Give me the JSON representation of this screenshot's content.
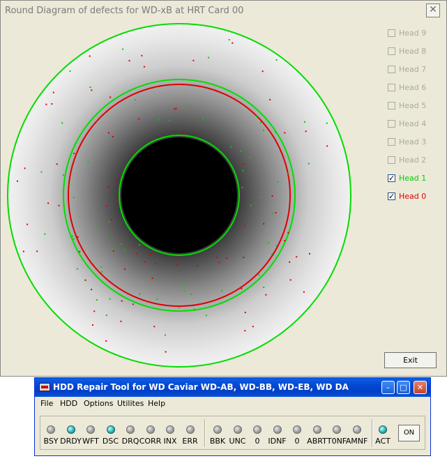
{
  "diagram_window": {
    "title": "Round Diagram of defects for WD-xB at HRT Card 00",
    "close_glyph": "✕",
    "exit_label": "Exit",
    "heads": [
      {
        "label": "Head 9",
        "checked": false,
        "enabled": false
      },
      {
        "label": "Head 8",
        "checked": false,
        "enabled": false
      },
      {
        "label": "Head 7",
        "checked": false,
        "enabled": false
      },
      {
        "label": "Head 6",
        "checked": false,
        "enabled": false
      },
      {
        "label": "Head 5",
        "checked": false,
        "enabled": false
      },
      {
        "label": "Head 4",
        "checked": false,
        "enabled": false
      },
      {
        "label": "Head 3",
        "checked": false,
        "enabled": false
      },
      {
        "label": "Head 2",
        "checked": false,
        "enabled": false
      },
      {
        "label": "Head 1",
        "checked": true,
        "enabled": true,
        "color": "#00cc00"
      },
      {
        "label": "Head 0",
        "checked": true,
        "enabled": true,
        "color": "#dd0000"
      }
    ],
    "colors": {
      "head0": "#dd0000",
      "head1": "#00cc00",
      "disk_hub": "#000000"
    }
  },
  "tool_window": {
    "title": "HDD Repair Tool for WD Caviar WD-AB, WD-BB, WD-EB, WD DA",
    "app_icon": "hdd-icon",
    "minimize_glyph": "–",
    "maximize_glyph": "□",
    "close_glyph": "✕",
    "menu": [
      "File",
      "HDD",
      "Options",
      "Utilites",
      "Help"
    ],
    "status_leds": [
      {
        "label": "BSY",
        "on": false
      },
      {
        "label": "DRDY",
        "on": true
      },
      {
        "label": "WFT",
        "on": false
      },
      {
        "label": "DSC",
        "on": true
      },
      {
        "label": "DRQ",
        "on": false
      },
      {
        "label": "CORR",
        "on": false
      },
      {
        "label": "INX",
        "on": false
      },
      {
        "label": "ERR",
        "on": false
      }
    ],
    "error_leds": [
      {
        "label": "BBK",
        "on": false
      },
      {
        "label": "UNC",
        "on": false
      },
      {
        "label": "0",
        "on": false
      },
      {
        "label": "IDNF",
        "on": false
      },
      {
        "label": "0",
        "on": false
      },
      {
        "label": "ABRT",
        "on": false
      },
      {
        "label": "T0NF",
        "on": false
      },
      {
        "label": "AMNF",
        "on": false
      }
    ],
    "act_led": {
      "label": "ACT",
      "on": true
    },
    "on_label": "ON"
  }
}
